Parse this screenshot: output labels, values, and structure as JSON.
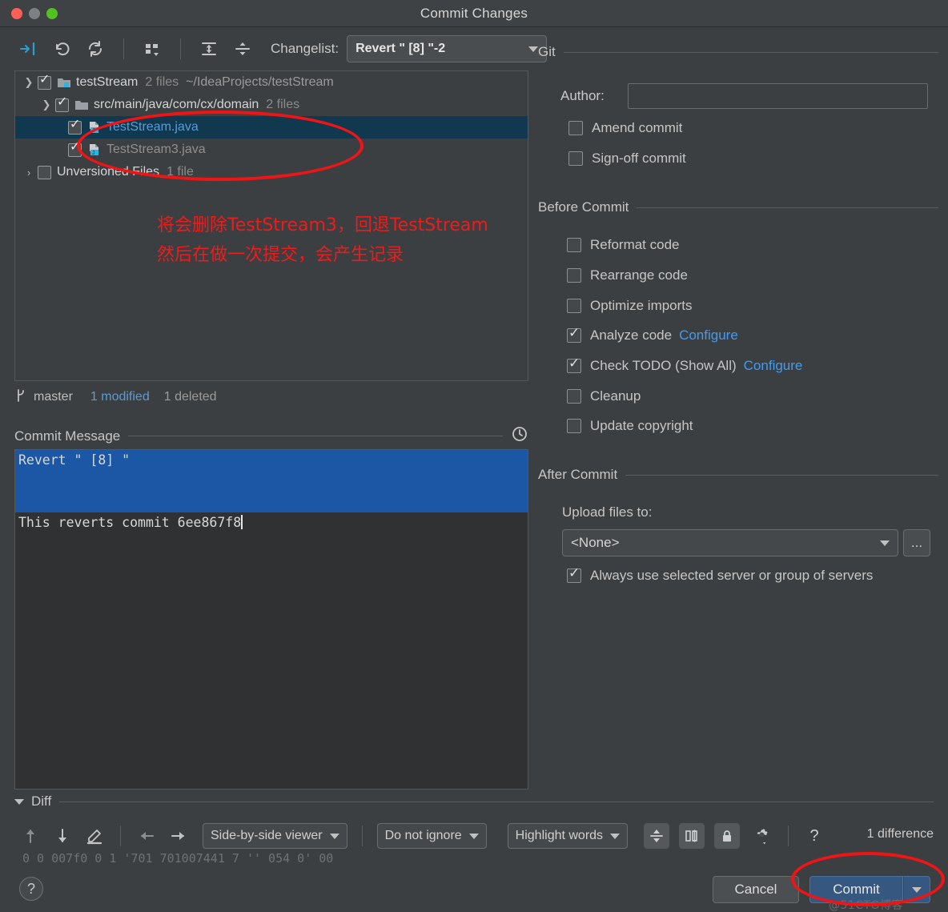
{
  "window": {
    "title": "Commit Changes",
    "traffic_lights": [
      "close-button",
      "minimize-button",
      "maximize-button"
    ]
  },
  "toolbar": {
    "icons": [
      "collapse-selection-icon",
      "revert-icon",
      "refresh-icon",
      "group-by-icon",
      "expand-all-icon",
      "collapse-all-icon"
    ],
    "changelist_label": "Changelist:",
    "changelist_value": "Revert \" [8] \"-2"
  },
  "tree": {
    "rows": [
      {
        "name": "testStream",
        "meta": "2 files",
        "path": "~/IdeaProjects/testStream",
        "checked": true,
        "expanded": true,
        "level": 0,
        "icon": "module-folder-icon",
        "style": "normal"
      },
      {
        "name": "src/main/java/com/cx/domain",
        "meta": "2 files",
        "path": "",
        "checked": true,
        "expanded": true,
        "level": 1,
        "icon": "folder-icon",
        "style": "normal"
      },
      {
        "name": "TestStream.java",
        "meta": "",
        "path": "",
        "checked": true,
        "expanded": null,
        "level": 2,
        "icon": "java-file-icon",
        "style": "modified",
        "selected": true
      },
      {
        "name": "TestStream3.java",
        "meta": "",
        "path": "",
        "checked": true,
        "expanded": null,
        "level": 2,
        "icon": "java-file-icon",
        "style": "deleted"
      },
      {
        "name": "Unversioned Files",
        "meta": "1 file",
        "path": "",
        "checked": false,
        "expanded": false,
        "level": 0,
        "icon": "",
        "style": "normal"
      }
    ]
  },
  "annotation": {
    "line1": "将会删除TestStream3，回退TestStream",
    "line2": "然后在做一次提交，会产生记录",
    "color": "#ee1b1b"
  },
  "status": {
    "branch": "master",
    "modified": "1 modified",
    "deleted": "1 deleted"
  },
  "commit_message": {
    "header": "Commit Message",
    "history_icon": "clock-icon",
    "line1": "Revert \" [8] \"",
    "line2": "",
    "line3": "This reverts commit 6ee867f8"
  },
  "git": {
    "header": "Git",
    "author_label": "Author:",
    "author_value": "",
    "amend_label": "Amend commit",
    "amend_checked": false,
    "signoff_label": "Sign-off commit",
    "signoff_checked": false
  },
  "before_commit": {
    "header": "Before Commit",
    "items": [
      {
        "label": "Reformat code",
        "checked": false,
        "link": ""
      },
      {
        "label": "Rearrange code",
        "checked": false,
        "link": ""
      },
      {
        "label": "Optimize imports",
        "checked": false,
        "link": ""
      },
      {
        "label": "Analyze code",
        "checked": true,
        "link": "Configure"
      },
      {
        "label": "Check TODO (Show All)",
        "checked": true,
        "link": "Configure"
      },
      {
        "label": "Cleanup",
        "checked": false,
        "link": ""
      },
      {
        "label": "Update copyright",
        "checked": false,
        "link": ""
      }
    ]
  },
  "after_commit": {
    "header": "After Commit",
    "upload_label": "Upload files to:",
    "upload_value": "<None>",
    "browse_label": "...",
    "always_label": "Always use selected server or group of servers",
    "always_checked": true
  },
  "diff": {
    "header": "Diff",
    "tool_icons": [
      "prev-difference-icon",
      "next-difference-icon",
      "edit-icon",
      "apply-left-icon",
      "apply-right-icon"
    ],
    "viewer_mode": "Side-by-side viewer",
    "ignore_mode": "Do not ignore",
    "highlight_mode": "Highlight words",
    "right_icons": [
      "collapse-unchanged-icon",
      "sync-scroll-icon",
      "lock-icon",
      "settings-gear-icon",
      "help-question-icon"
    ],
    "difference_count": "1 difference",
    "clipped_text": "0 0   007f0  0    1  '701  701007441  7 '' 054  0'  00"
  },
  "bottom": {
    "help_label": "?",
    "cancel_label": "Cancel",
    "commit_label": "Commit",
    "commit_dropdown_icon": "chevron-down-icon"
  },
  "watermark": "@51CTO博客",
  "colors": {
    "window_bg": "#3c3f41",
    "accent_blue": "#5b9bd5",
    "link_blue": "#3f9cf5",
    "selection_blue": "#1b57a5",
    "tree_selected": "#10384f",
    "commit_button": "#365880",
    "annotation_red": "#ee1b1b"
  }
}
